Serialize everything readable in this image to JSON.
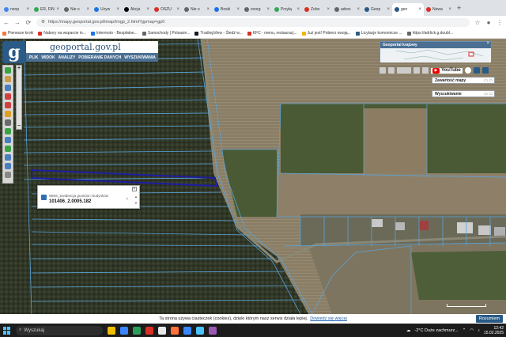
{
  "browser": {
    "tabs": [
      {
        "label": "neop",
        "color": "#4285f4"
      },
      {
        "label": "ER, FINAN",
        "color": "#34a853"
      },
      {
        "label": "Nie o",
        "color": "#666666"
      },
      {
        "label": "Używ",
        "color": "#1a73e8"
      },
      {
        "label": "Akcja",
        "color": "#000000"
      },
      {
        "label": "OSZU",
        "color": "#d93025"
      },
      {
        "label": "Nie o",
        "color": "#666666"
      },
      {
        "label": "Boski",
        "color": "#1a73e8"
      },
      {
        "label": "exorg",
        "color": "#666666"
      },
      {
        "label": "Przyłą",
        "color": "#34a853"
      },
      {
        "label": "Zobo",
        "color": "#d93025"
      },
      {
        "label": "adres",
        "color": "#666666"
      },
      {
        "label": "Geop",
        "color": "#2a5a86"
      },
      {
        "label": "geo",
        "color": "#2a5a86",
        "active": true
      },
      {
        "label": "Nowa",
        "color": "#d93025"
      }
    ],
    "url": "https://mapy.geoportal.gov.pl/imap/Imgp_2.html?gpmap=gp0",
    "bookmarks": [
      {
        "label": "Pierwsze kroki",
        "color": "#ff7139"
      },
      {
        "label": "Nabory na wsparcie in...",
        "color": "#d93025"
      },
      {
        "label": "Intermoto - Bezpłatne...",
        "color": "#1a73e8"
      },
      {
        "label": "Samochody | Polsasin...",
        "color": "#666666"
      },
      {
        "label": "TradingView - Śledź w...",
        "color": "#131722"
      },
      {
        "label": "KFC - menu, restauracj...",
        "color": "#d93025"
      },
      {
        "label": "Już jest! Pobierz swoją...",
        "color": "#f4b400"
      },
      {
        "label": "Licytacje komornicze ...",
        "color": "#2a5a86"
      },
      {
        "label": "https://adrlick.g.doubl...",
        "color": "#666666"
      }
    ]
  },
  "geoportal": {
    "logo_letter": "g",
    "title": "geoportal.gov.pl",
    "menu": [
      "PLIK",
      "WIDOK",
      "ANALIZY",
      "POBIERANIE DANYCH",
      "WYSZUKIWANIA"
    ],
    "overview_title": "Geoportal krajowy",
    "youtube_label": "YouTube",
    "panel_contents": "Zawartość mapy",
    "panel_search": "Wyszukiwanie",
    "popup": {
      "layer": "WMS_Ewidencja gruntów i budynków",
      "parcel": "101406_2.0005.182"
    }
  },
  "cookie": {
    "text": "Ta strona używa ciasteczek (cookies), dzięki którym nasz serwis działa lepiej.",
    "link": "Dowiedz się więcej",
    "button": "Rozumiem"
  },
  "taskbar": {
    "search_placeholder": "Wyszukaj",
    "apps": [
      "#f0c000",
      "#3a86ff",
      "#2aa05a",
      "#d93025",
      "#e8e8e8",
      "#ff7139",
      "#3a86ff",
      "#4cc2ff",
      "#9b59b6"
    ],
    "weather": "-2°C  Duże zachmurz...",
    "time": "12:42",
    "date": "15.02.2025"
  },
  "colors": {
    "accent": "#2a5a86",
    "parcel_lines": "#5aa3d8",
    "selection": "#1e1ea0"
  }
}
